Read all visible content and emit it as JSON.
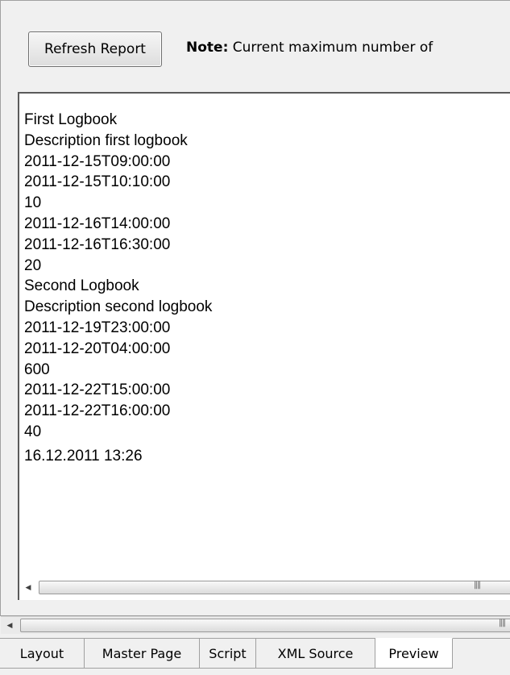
{
  "toolbar": {
    "refresh_label": "Refresh Report",
    "note_bold": "Note:",
    "note_text": " Current maximum number of"
  },
  "report": {
    "lines": [
      "First Logbook",
      "Description first logbook",
      "2011-12-15T09:00:00",
      "2011-12-15T10:10:00",
      "10",
      "2011-12-16T14:00:00",
      "2011-12-16T16:30:00",
      "20",
      "Second Logbook",
      "Description second logbook",
      "2011-12-19T23:00:00",
      "2011-12-20T04:00:00",
      "600",
      "2011-12-22T15:00:00",
      "2011-12-22T16:00:00",
      "40"
    ],
    "timestamp": "16.12.2011 13:26"
  },
  "tabs": [
    {
      "label": "Layout"
    },
    {
      "label": "Master Page"
    },
    {
      "label": "Script"
    },
    {
      "label": "XML Source"
    },
    {
      "label": "Preview"
    }
  ],
  "icons": {
    "scroll_left": "scroll-left-arrow-icon",
    "grip": "scroll-grip-icon"
  }
}
